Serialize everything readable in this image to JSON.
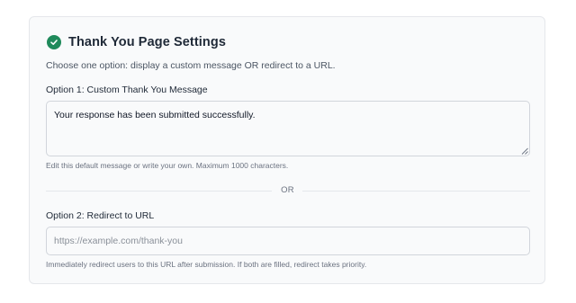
{
  "header": {
    "title": "Thank You Page Settings",
    "subtitle": "Choose one option: display a custom message OR redirect to a URL.",
    "icon": "check-circle-icon",
    "icon_color": "#1f8a5b"
  },
  "option1": {
    "label": "Option 1: Custom Thank You Message",
    "value": "Your response has been submitted successfully.",
    "help": "Edit this default message or write your own. Maximum 1000 characters."
  },
  "divider": {
    "text": "OR"
  },
  "option2": {
    "label": "Option 2: Redirect to URL",
    "value": "",
    "placeholder": "https://example.com/thank-you",
    "help": "Immediately redirect users to this URL after submission. If both are filled, redirect takes priority."
  }
}
